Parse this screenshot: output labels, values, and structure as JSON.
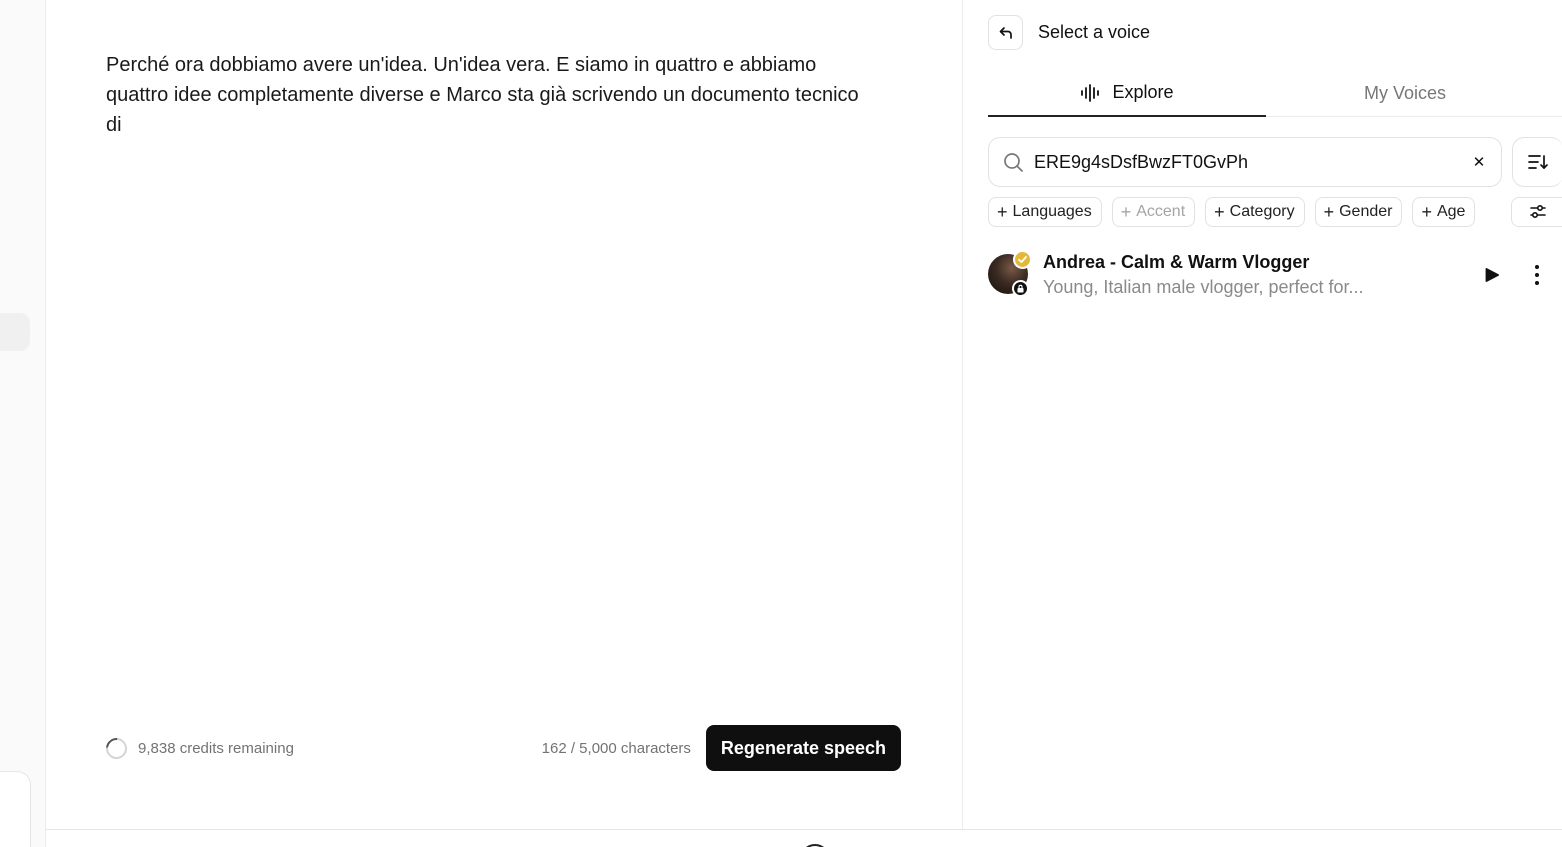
{
  "editor": {
    "text": "Perché ora dobbiamo avere un'idea. Un'idea vera. E siamo in quattro e abbiamo quattro idee completamente diverse e Marco sta già scrivendo un documento tecnico di",
    "credits_remaining": "9,838 credits remaining",
    "character_count": "162 / 5,000 characters",
    "regenerate_label": "Regenerate speech"
  },
  "voice_panel": {
    "title": "Select a voice",
    "tabs": [
      {
        "label": "Explore",
        "active": true,
        "icon": "waveform-icon"
      },
      {
        "label": "My Voices",
        "active": false
      }
    ],
    "search": {
      "value": "ERE9g4sDsfBwzFT0GvPh"
    },
    "filters": [
      {
        "label": "Languages",
        "enabled": true
      },
      {
        "label": "Accent",
        "enabled": false
      },
      {
        "label": "Category",
        "enabled": true
      },
      {
        "label": "Gender",
        "enabled": true
      },
      {
        "label": "Age",
        "enabled": true
      }
    ],
    "voices": [
      {
        "name": "Andrea - Calm & Warm Vlogger",
        "description": "Young, Italian male vlogger, perfect for...",
        "verified": true,
        "locked": true
      }
    ]
  },
  "colors": {
    "accent_dark": "#0f0f0f",
    "verified_badge": "#e2b93b",
    "muted_text": "#737373"
  }
}
